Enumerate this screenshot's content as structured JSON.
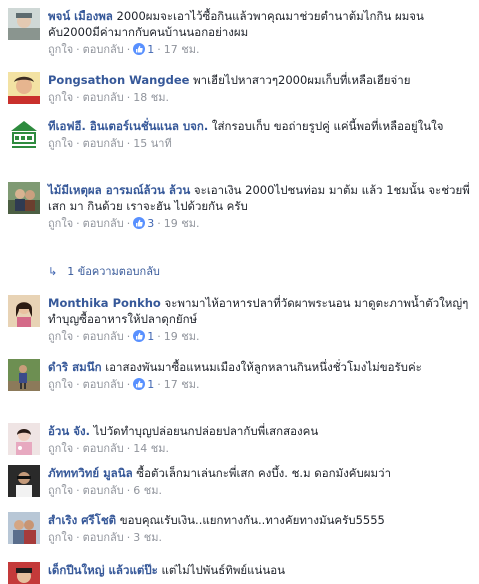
{
  "comments": [
    {
      "name": "พจน์ เมืองพล",
      "text": "2000ผมจะเอาไว้ซื้อกินแล้วพาคุณมาช่วยตำนาต้มไกกิน ผมจนคับ2000มีค่ามากกับคนบ้านนอกอย่างผม",
      "like": "ถูกใจ",
      "reply": "ตอบกลับ",
      "likes": "1",
      "time": "17 ชม."
    },
    {
      "name": "Pongsathon Wangdee",
      "text": "พาเฮียไปหาสาวๆ2000ผมเก็บที่เหลือเฮียจ่าย",
      "like": "ถูกใจ",
      "reply": "ตอบกลับ",
      "likes": "",
      "time": "18 ชม."
    },
    {
      "name": "ทีเอฟอี. อินเตอร์เนชั่นแนล บจก.",
      "text": "ใส่กรอบเก็บ ขอถ่ายรูปคู่ แค่นี้พอที่เหลืออยู่ในใจ",
      "like": "ถูกใจ",
      "reply": "ตอบกลับ",
      "likes": "",
      "time": "15 นาที"
    },
    {
      "name": "ไม้มีเหตุผล อารมณ์ล้วน ล้วน",
      "text": "จะเอาเงิน 2000ไปชนท่อม มาต้ม แล้ว 1ชมนั้น จะช่วยพี่เสก มา กินด้วย เราจะฮัน ไปด้วยกัน ครับ",
      "like": "ถูกใจ",
      "reply": "ตอบกลับ",
      "likes": "3",
      "time": "19 ชม."
    },
    {
      "name": "Monthika Ponkho",
      "text": "จะพามาไห้อาหารปลาที่วัดผาพระนอน มาดูตะภาพน้ำตัวใหญ่ๆ ทำบุญซื้ออาหารให้ปลาดุกยักษ์",
      "like": "ถูกใจ",
      "reply": "ตอบกลับ",
      "likes": "1",
      "time": "19 ชม."
    },
    {
      "name": "ดำริ สมนึก",
      "text": "เอาสองพันมาซื้อแหนมเมืองให้ลูกหลานกินหนึ่งชั่วโมงไม่ขอรับค่ะ",
      "like": "ถูกใจ",
      "reply": "ตอบกลับ",
      "likes": "1",
      "time": "17 ชม."
    },
    {
      "name": "อ้วน จัง.",
      "text": "ไปวัดทำบุญปล่อยนกปล่อยปลากับพี่เสกสองคน",
      "like": "ถูกใจ",
      "reply": "ตอบกลับ",
      "likes": "",
      "time": "14 ชม."
    },
    {
      "name": "ภัทททวิทย์ มูลนิล",
      "text": "ซื้อตัวเล็กมาเล่นกะพี่เสก คงบึ้ง. ช.ม ดอกมังคับผมว่า",
      "like": "ถูกใจ",
      "reply": "ตอบกลับ",
      "likes": "",
      "time": "6 ชม."
    },
    {
      "name": "สำเริง ศรีโชติ",
      "text": "ขอบคุณเรับเงิน..แยกทางกัน..ทางคัยทางมันครับ5555",
      "like": "ถูกใจ",
      "reply": "ตอบกลับ",
      "likes": "",
      "time": "3 ชม."
    },
    {
      "name": "เด็กปีนใหญ่ แล้วแต่ป๊ะ",
      "text": "แต่ไม่ไปพันธ์ทิพย์แน่นอน",
      "like": "",
      "reply": "",
      "likes": "",
      "time": ""
    }
  ],
  "replies_link": {
    "label": "1 ข้อความตอบกลับ"
  }
}
